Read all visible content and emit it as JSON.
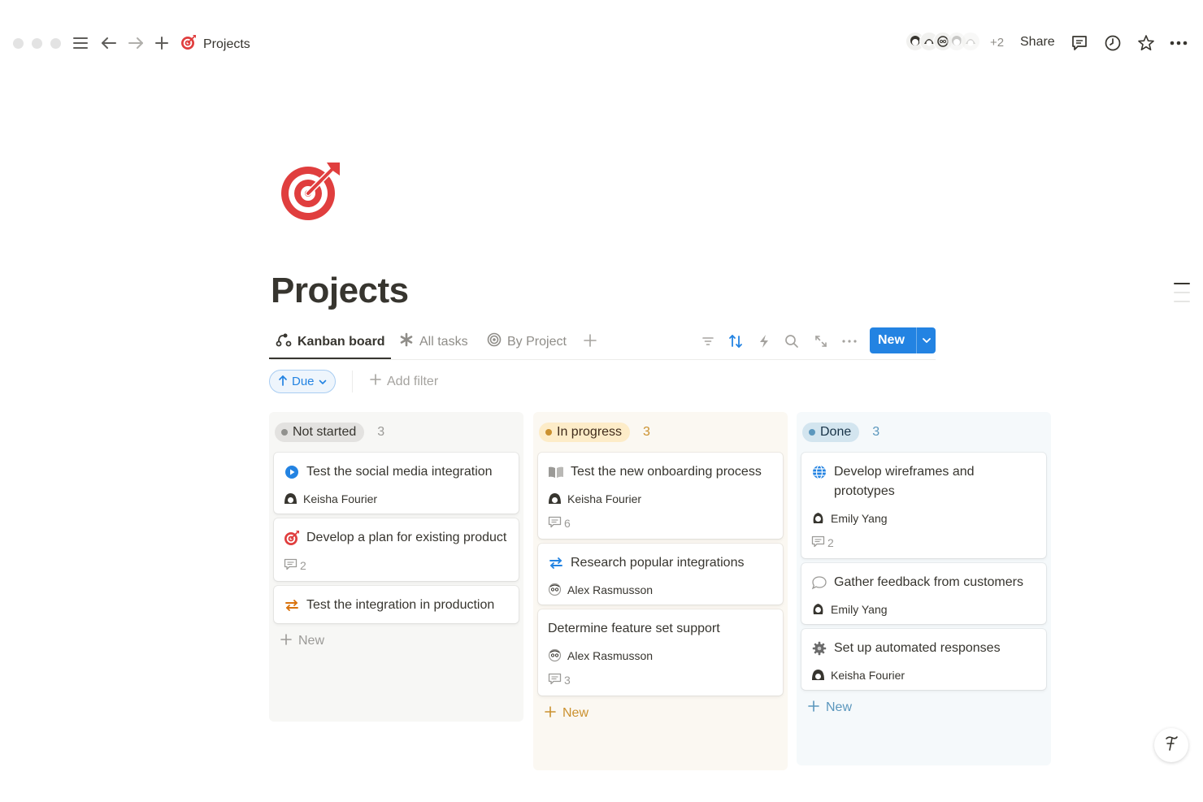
{
  "topbar": {
    "breadcrumb": "Projects",
    "extra_count": "+2",
    "share_label": "Share"
  },
  "page": {
    "title": "Projects",
    "icon": "target-icon"
  },
  "tabs": [
    {
      "label": "Kanban board",
      "icon": "kanban-icon",
      "active": true
    },
    {
      "label": "All tasks",
      "icon": "asterisk-icon",
      "active": false
    },
    {
      "label": "By Project",
      "icon": "target-outline-icon",
      "active": false
    }
  ],
  "toolbar": {
    "new_label": "New"
  },
  "filters": {
    "sort_label": "Due",
    "add_filter_label": "Add filter"
  },
  "colors": {
    "accent": "#2383e2",
    "not_started": "#e3e2e0",
    "in_progress": "#fdecc8",
    "done": "#d3e5ef"
  },
  "board": {
    "columns": [
      {
        "status": "Not started",
        "count": "3",
        "new_label": "New",
        "cards": [
          {
            "title": "Test the social media integration",
            "icon": "play-circle-icon",
            "assignee": "Keisha Fourier"
          },
          {
            "title": "Develop a plan for existing product",
            "icon": "target-icon",
            "comments": "2"
          },
          {
            "title": "Test the integration in production",
            "icon": "arrows-swap-icon"
          }
        ]
      },
      {
        "status": "In progress",
        "count": "3",
        "new_label": "New",
        "cards": [
          {
            "title": "Test the new onboarding process",
            "icon": "book-icon",
            "assignee": "Keisha Fourier",
            "comments": "6"
          },
          {
            "title": "Research popular integrations",
            "icon": "arrows-swap-icon",
            "assignee": "Alex Rasmusson"
          },
          {
            "title": "Determine feature set support",
            "assignee": "Alex Rasmusson",
            "comments": "3"
          }
        ]
      },
      {
        "status": "Done",
        "count": "3",
        "new_label": "New",
        "cards": [
          {
            "title": "Develop wireframes and prototypes",
            "icon": "globe-icon",
            "assignee": "Emily Yang",
            "comments": "2"
          },
          {
            "title": "Gather feedback from customers",
            "icon": "speech-bubble-icon",
            "assignee": "Emily Yang"
          },
          {
            "title": "Set up automated responses",
            "icon": "gear-icon",
            "assignee": "Keisha Fourier"
          }
        ]
      }
    ]
  }
}
